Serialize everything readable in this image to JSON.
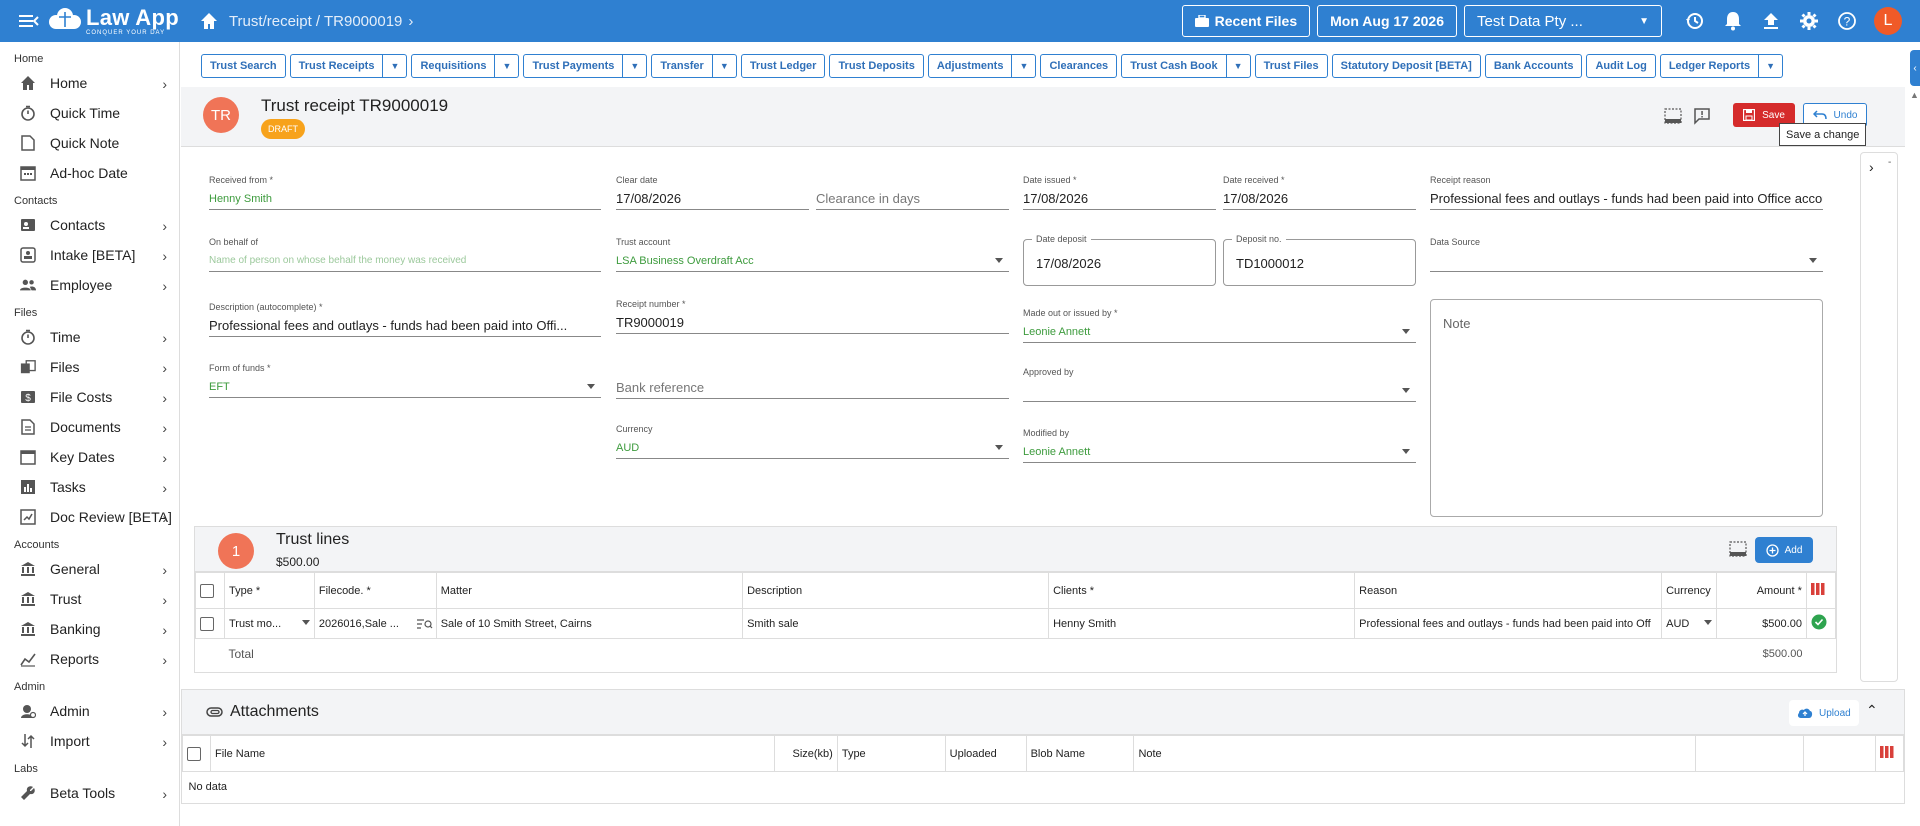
{
  "topbar": {
    "logo_main": "Law App",
    "logo_tag": "CONQUER YOUR DAY",
    "breadcrumb": "Trust/receipt / TR9000019",
    "recent_files": "Recent Files",
    "date": "Mon Aug 17 2026",
    "company": "Test Data Pty ...",
    "user_initial": "L"
  },
  "sidebar": {
    "sections": {
      "home": "Home",
      "contacts": "Contacts",
      "files": "Files",
      "accounts": "Accounts",
      "admin": "Admin",
      "labs": "Labs"
    },
    "items": {
      "home": "Home",
      "quick_time": "Quick Time",
      "quick_note": "Quick Note",
      "adhoc_date": "Ad-hoc Date",
      "contacts": "Contacts",
      "intake": "Intake [BETA]",
      "employee": "Employee",
      "time": "Time",
      "files": "Files",
      "file_costs": "File Costs",
      "documents": "Documents",
      "key_dates": "Key Dates",
      "tasks": "Tasks",
      "doc_review": "Doc Review [BETA]",
      "general": "General",
      "trust": "Trust",
      "banking": "Banking",
      "reports": "Reports",
      "admin": "Admin",
      "import": "Import",
      "beta_tools": "Beta Tools"
    }
  },
  "toolbar": {
    "trust_search": "Trust Search",
    "trust_receipts": "Trust Receipts",
    "requisitions": "Requisitions",
    "trust_payments": "Trust Payments",
    "transfer": "Transfer",
    "trust_ledger": "Trust Ledger",
    "trust_deposits": "Trust Deposits",
    "adjustments": "Adjustments",
    "clearances": "Clearances",
    "trust_cash_book": "Trust Cash Book",
    "trust_files": "Trust Files",
    "statutory_deposit": "Statutory Deposit [BETA]",
    "bank_accounts": "Bank Accounts",
    "audit_log": "Audit Log",
    "ledger_reports": "Ledger Reports"
  },
  "header": {
    "avatar": "TR",
    "title": "Trust receipt TR9000019",
    "status": "DRAFT",
    "save": "Save",
    "undo": "Undo",
    "tooltip": "Save a change"
  },
  "form": {
    "received_from": {
      "label": "Received from *",
      "value": "Henny Smith"
    },
    "on_behalf_of": {
      "label": "On behalf of",
      "placeholder": "Name of person on whose behalf the money was received"
    },
    "description": {
      "label": "Description (autocomplete) *",
      "value": "Professional fees and outlays - funds had been paid into Offi..."
    },
    "form_of_funds": {
      "label": "Form of funds *",
      "value": "EFT"
    },
    "clear_date": {
      "label": "Clear date",
      "value": "17/08/2026"
    },
    "clearance_days": {
      "placeholder": "Clearance in days"
    },
    "trust_account": {
      "label": "Trust account",
      "value": "LSA Business Overdraft Acc"
    },
    "receipt_number": {
      "label": "Receipt number *",
      "value": "TR9000019"
    },
    "bank_reference": {
      "placeholder": "Bank reference"
    },
    "currency": {
      "label": "Currency",
      "value": "AUD"
    },
    "date_issued": {
      "label": "Date issued *",
      "value": "17/08/2026"
    },
    "date_received": {
      "label": "Date received *",
      "value": "17/08/2026"
    },
    "date_deposit": {
      "label": "Date deposit",
      "value": "17/08/2026"
    },
    "deposit_no": {
      "label": "Deposit no.",
      "value": "TD1000012"
    },
    "made_out_by": {
      "label": "Made out or issued by *",
      "value": "Leonie Annett"
    },
    "approved_by": {
      "label": "Approved by",
      "value": ""
    },
    "modified_by": {
      "label": "Modified by",
      "value": "Leonie Annett"
    },
    "receipt_reason": {
      "label": "Receipt reason",
      "value": "Professional fees and outlays - funds had been paid into Office accou"
    },
    "data_source": {
      "label": "Data Source",
      "value": ""
    },
    "note": {
      "placeholder": "Note"
    }
  },
  "trust_lines": {
    "count": "1",
    "title": "Trust lines",
    "amount": "$500.00",
    "add": "Add",
    "columns": [
      "Type *",
      "Filecode. *",
      "Matter",
      "Description",
      "Clients *",
      "Reason",
      "Currency",
      "Amount *"
    ],
    "rows": [
      {
        "type": "Trust mo...",
        "filecode": "2026016,Sale ...",
        "matter": "Sale of 10 Smith Street, Cairns",
        "description": "Smith sale",
        "clients": "Henny Smith",
        "reason": "Professional fees and outlays - funds had been paid into Off",
        "currency": "AUD",
        "amount": "$500.00"
      }
    ],
    "total_label": "Total",
    "total_value": "$500.00"
  },
  "attachments": {
    "title": "Attachments",
    "upload": "Upload",
    "columns": [
      "File Name",
      "Size(kb)",
      "Type",
      "Uploaded",
      "Blob Name",
      "Note"
    ],
    "empty": "No data"
  },
  "colors": {
    "primary": "#2f80d1",
    "save": "#d52b2b",
    "badge": "#f7a21b",
    "avatar": "#f07457",
    "green_value": "#3d9b3d"
  }
}
